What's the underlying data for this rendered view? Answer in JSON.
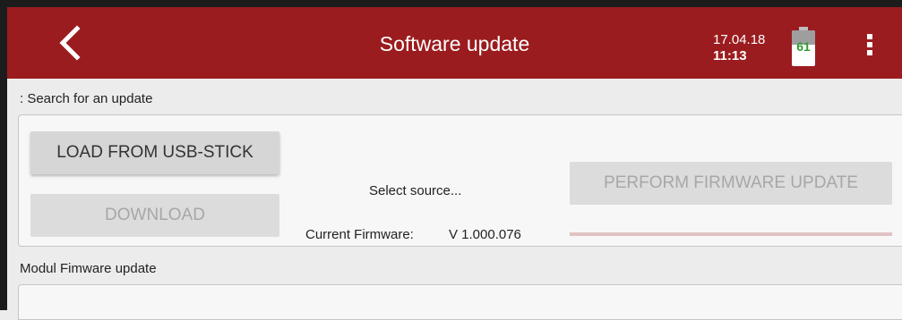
{
  "header": {
    "title": "Software update",
    "date": "17.04.18",
    "time": "11:13",
    "battery_percent": "61",
    "back_icon": "chevron-left-icon",
    "menu_icon": "more-vertical-icon",
    "bar_color": "#9b1c1f"
  },
  "search_section": {
    "label": ": Search for an update",
    "load_usb_label": "LOAD FROM USB-STICK",
    "download_label": "DOWNLOAD",
    "select_source_text": "Select source...",
    "perform_update_label": "PERFORM FIRMWARE UPDATE",
    "current_firmware_label": "Current Firmware:",
    "current_firmware_value": "V 1.000.076",
    "progress_fraction": 0
  },
  "modul_section": {
    "label": "Modul Fimware update"
  }
}
